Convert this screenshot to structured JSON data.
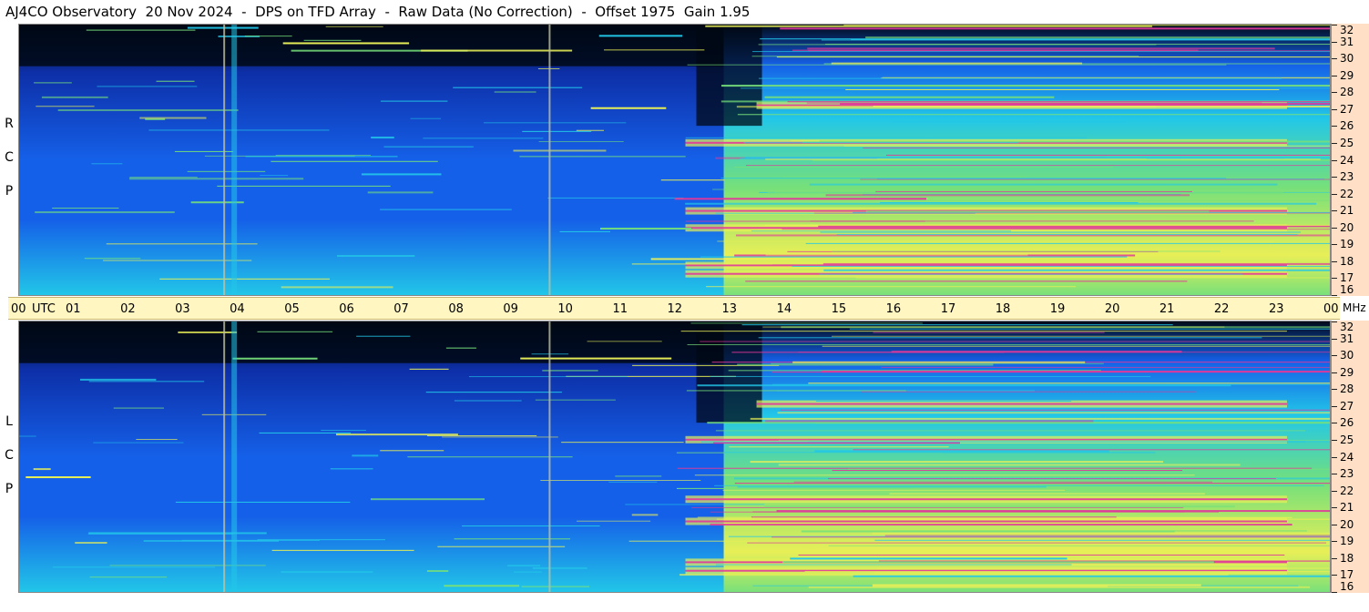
{
  "header": {
    "title": "AJ4CO Observatory  20 Nov 2024  -  DPS on TFD Array  -  Raw Data (No Correction)  -  Offset 1975  Gain 1.95"
  },
  "panels": {
    "top_label": [
      "R",
      "C",
      "P"
    ],
    "bottom_label": [
      "L",
      "C",
      "P"
    ]
  },
  "axis": {
    "time_ticks": [
      "00",
      "01",
      "02",
      "03",
      "04",
      "05",
      "06",
      "07",
      "08",
      "09",
      "10",
      "11",
      "12",
      "13",
      "14",
      "15",
      "16",
      "17",
      "18",
      "19",
      "20",
      "21",
      "22",
      "23",
      "00"
    ],
    "utc_label": "UTC",
    "freq_ticks": [
      "16",
      "17",
      "18",
      "19",
      "20",
      "21",
      "22",
      "23",
      "24",
      "25",
      "26",
      "27",
      "28",
      "29",
      "30",
      "31",
      "32"
    ],
    "freq_unit": "MHz"
  },
  "colors": {
    "dark": "#000814",
    "deep_blue": "#0d2fa8",
    "blue": "#1560e8",
    "cyan": "#22c7e8",
    "green": "#76e07a",
    "yellow": "#e8ef57",
    "magenta": "#e0389a",
    "axis_bg": "#fff6c2",
    "freq_bg": "#ffe0c6"
  },
  "chart_data": {
    "type": "heatmap",
    "title": "AJ4CO Observatory  20 Nov 2024  -  DPS on TFD Array  -  Raw Data (No Correction)  -  Offset 1975  Gain 1.95",
    "x_range": [
      "00 UTC",
      "00 UTC (+24h)"
    ],
    "y_range_mhz": [
      16,
      32
    ],
    "panels": [
      {
        "name": "RCP",
        "bright_hours": [
          12.9,
          24
        ],
        "strong_bands_mhz": [
          27.2,
          25.0,
          17.3,
          17.8,
          20.0,
          21.0
        ],
        "vertical_lines_hours": [
          3.75,
          3.9,
          9.7
        ]
      },
      {
        "name": "LCP",
        "bright_hours": [
          12.9,
          24
        ],
        "strong_bands_mhz": [
          27.1,
          25.0,
          17.3,
          17.8,
          20.2,
          21.5
        ],
        "vertical_lines_hours": [
          3.75,
          3.9,
          9.7
        ]
      }
    ]
  }
}
